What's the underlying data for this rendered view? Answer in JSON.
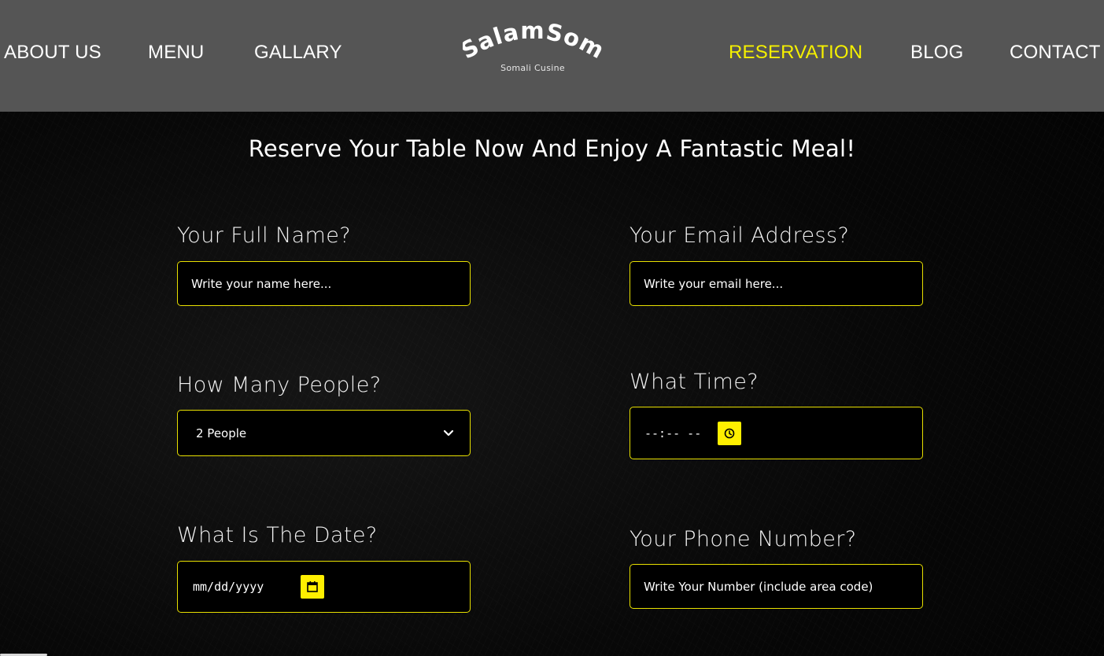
{
  "nav": {
    "left": [
      "ABOUT US",
      "MENU",
      "GALLARY"
    ],
    "right": [
      "RESERVATION",
      "BLOG",
      "CONTACT"
    ],
    "active": "RESERVATION"
  },
  "logo": {
    "title": "SalamSom",
    "subtitle": "Somali Cusine"
  },
  "main": {
    "subtitle": "Reserve Your Table Now And Enjoy A Fantastic Meal!"
  },
  "form": {
    "name": {
      "label": "Your Full Name?",
      "placeholder": "Write your name here..."
    },
    "email": {
      "label": "Your Email Address?",
      "placeholder": "Write your email here..."
    },
    "people": {
      "label": "How Many People?",
      "selected": "2 People"
    },
    "time": {
      "label": "What Time?",
      "value": "--:-- --",
      "icon": "clock-icon"
    },
    "date": {
      "label": "What Is The Date?",
      "value": "mm/dd/yyyy",
      "icon": "calendar-icon"
    },
    "phone": {
      "label": "Your Phone Number?",
      "placeholder": "Write Your Number (include area code)"
    }
  },
  "colors": {
    "header_bg": "#555555",
    "accent": "#f5f000",
    "field_border": "#e8e000",
    "page_bg": "#050505",
    "text": "#ffffff"
  }
}
